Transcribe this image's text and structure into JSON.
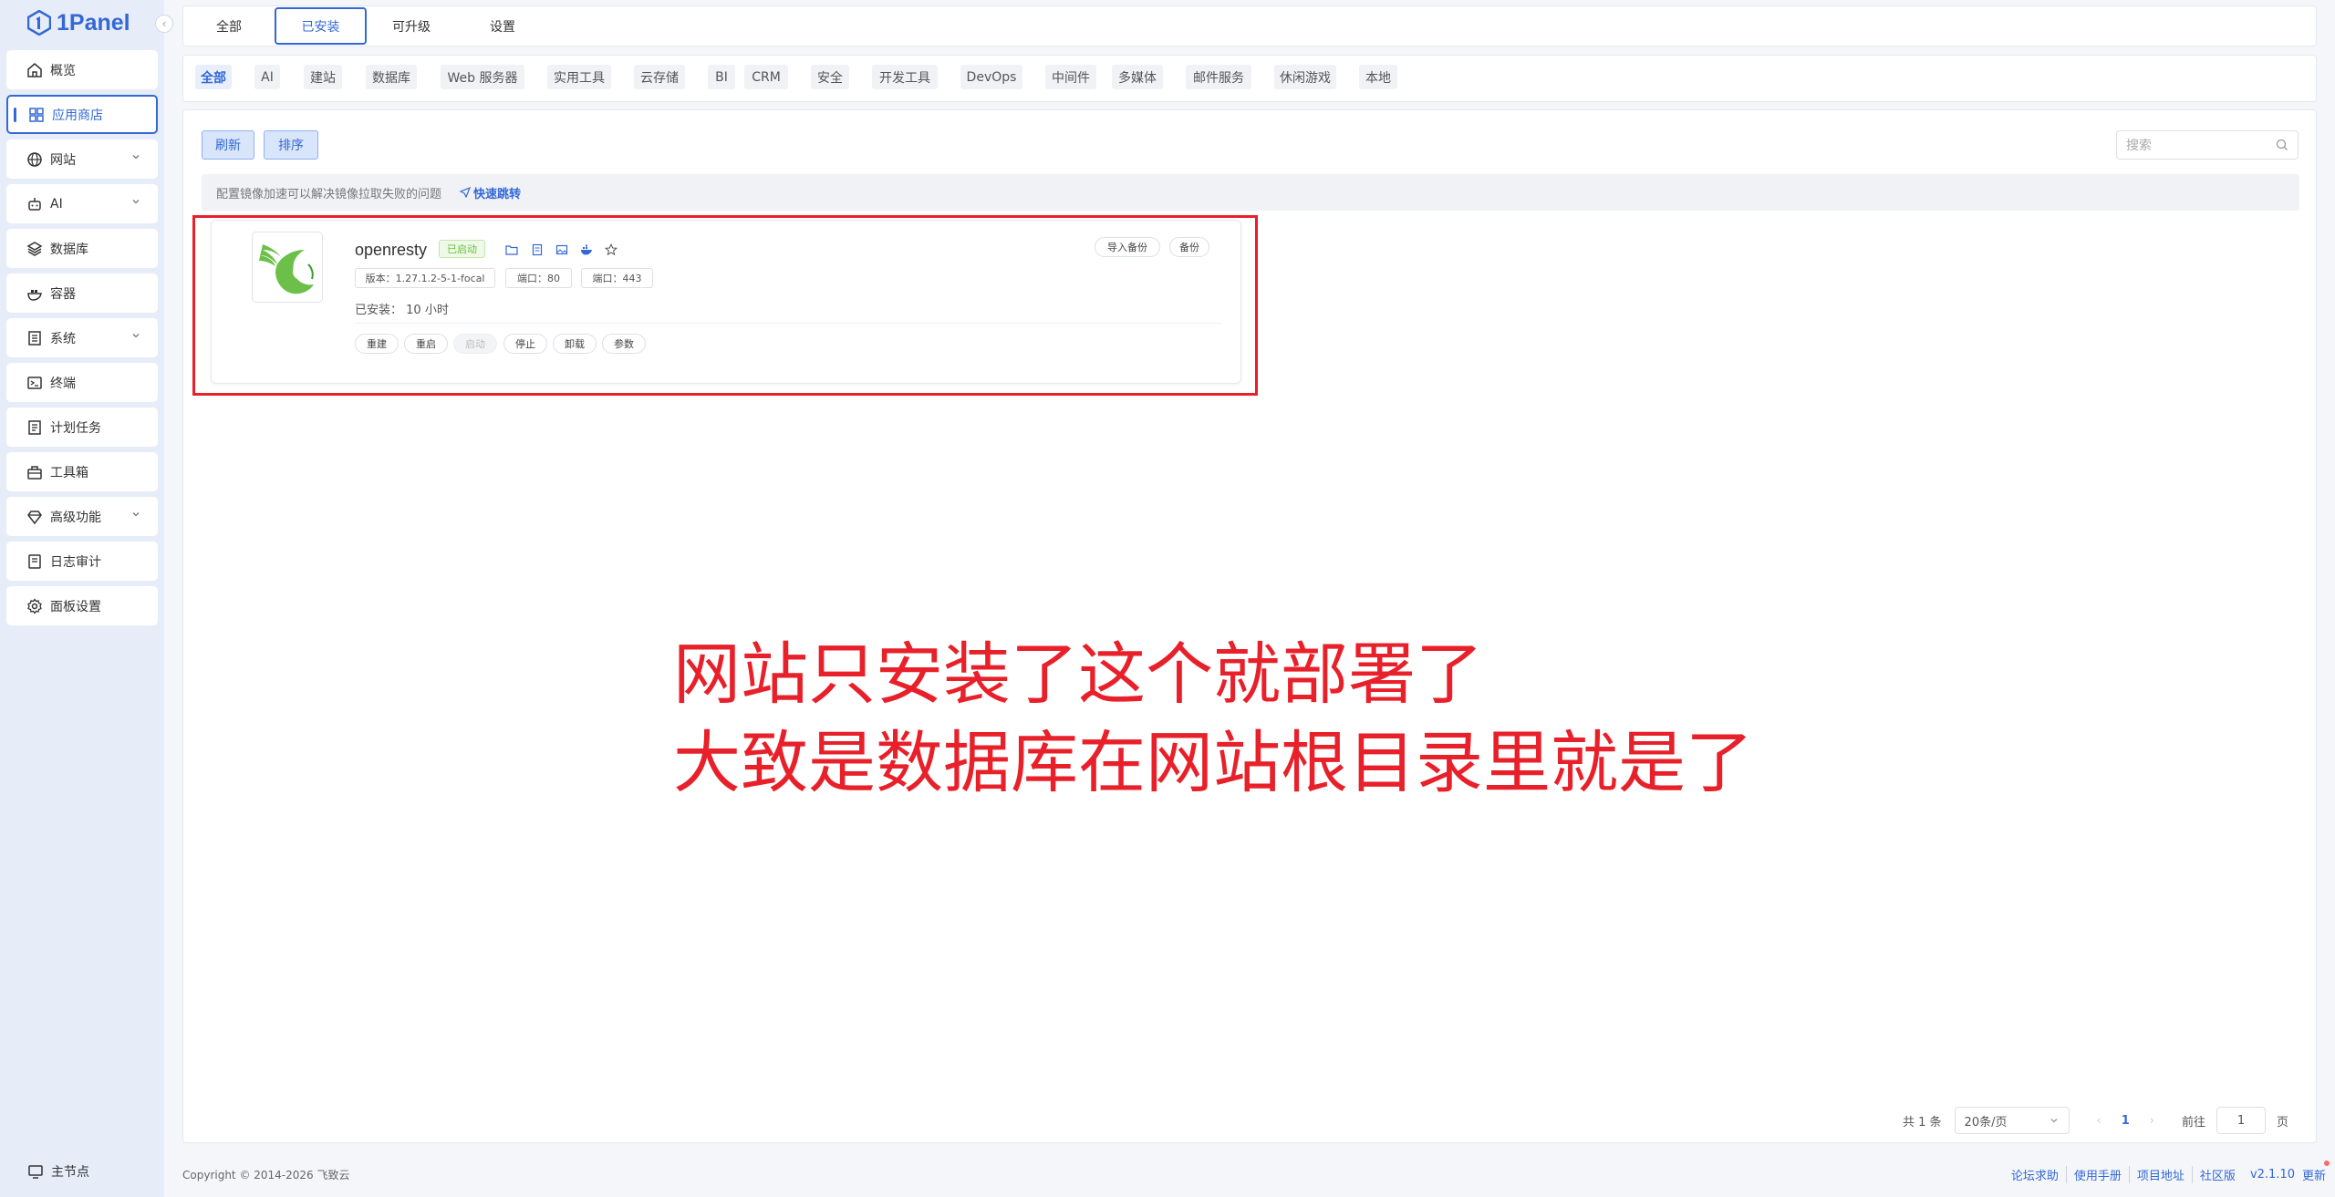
{
  "brand": {
    "name": "1Panel"
  },
  "sidebar": {
    "items": [
      {
        "label": "概览"
      },
      {
        "label": "应用商店"
      },
      {
        "label": "网站"
      },
      {
        "label": "AI"
      },
      {
        "label": "数据库"
      },
      {
        "label": "容器"
      },
      {
        "label": "系统"
      },
      {
        "label": "终端"
      },
      {
        "label": "计划任务"
      },
      {
        "label": "工具箱"
      },
      {
        "label": "高级功能"
      },
      {
        "label": "日志审计"
      },
      {
        "label": "面板设置"
      }
    ],
    "active_index": 1,
    "node": "主节点"
  },
  "tabs": [
    {
      "label": "全部"
    },
    {
      "label": "已安装"
    },
    {
      "label": "可升级"
    },
    {
      "label": "设置"
    }
  ],
  "active_tab": 1,
  "categories": [
    "全部",
    "AI",
    "建站",
    "数据库",
    "Web 服务器",
    "实用工具",
    "云存储",
    "BI",
    "CRM",
    "安全",
    "开发工具",
    "DevOps",
    "中间件",
    "多媒体",
    "邮件服务",
    "休闲游戏",
    "本地"
  ],
  "active_category": 0,
  "toolbar": {
    "refresh": "刷新",
    "sort": "排序",
    "search_placeholder": "搜索"
  },
  "notice": {
    "text": "配置镜像加速可以解决镜像拉取失败的问题",
    "link": "快速跳转"
  },
  "app": {
    "name": "openresty",
    "status": "已启动",
    "version": "版本：1.27.1.2-5-1-focal",
    "port1": "端口：80",
    "port2": "端口：443",
    "installed_label": "已安装：",
    "installed_value": "10 小时",
    "import_backup": "导入备份",
    "backup": "备份",
    "ops": [
      "重建",
      "重启",
      "启动",
      "停止",
      "卸载",
      "参数"
    ],
    "disabled_op": "启动",
    "brand_color": "#6cc04a"
  },
  "annotation": {
    "line1": "网站只安装了这个就部署了",
    "line2": "大致是数据库在网站根目录里就是了",
    "color": "#e8202a"
  },
  "pagination": {
    "total": "共 1 条",
    "page_size": "20条/页",
    "current": "1",
    "goto": "前往",
    "page_value": "1",
    "page_unit": "页"
  },
  "footer": {
    "copyright": "Copyright © 2014-2026 飞致云",
    "links": [
      "论坛求助",
      "使用手册",
      "项目地址",
      "社区版"
    ],
    "version": "v2.1.10",
    "update": "更新"
  },
  "colors": {
    "accent": "#3368d6",
    "sidebar_bg": "#e6edf8",
    "page_bg": "#f4f6fa"
  }
}
